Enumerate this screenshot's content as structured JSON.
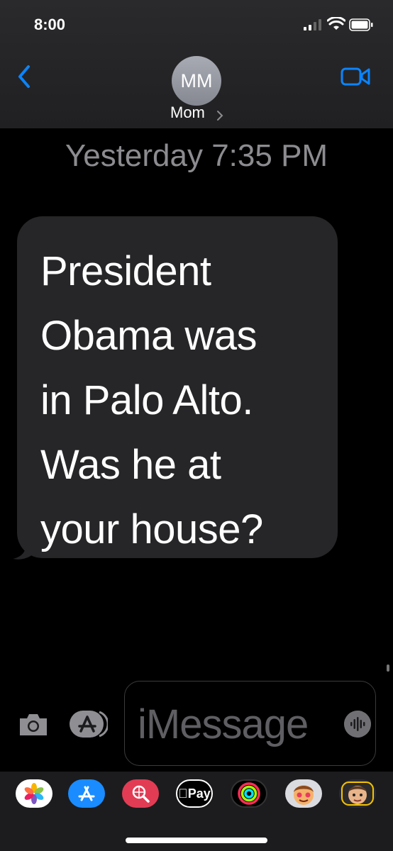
{
  "status_bar": {
    "time": "8:00"
  },
  "header": {
    "avatar_initials": "MM",
    "contact_name": "Mom"
  },
  "conversation": {
    "timestamp": "Yesterday 7:35 PM",
    "messages": [
      {
        "direction": "incoming",
        "text": "President\nObama was\nin Palo Alto.\nWas he at\nyour house?"
      }
    ]
  },
  "input_bar": {
    "placeholder": "iMessage"
  },
  "app_tray": {
    "items": [
      {
        "name": "photos-icon"
      },
      {
        "name": "app-store-icon"
      },
      {
        "name": "web-search-icon"
      },
      {
        "name": "apple-pay-icon",
        "label": "Pay"
      },
      {
        "name": "activity-icon"
      },
      {
        "name": "memoji-stickers-icon"
      },
      {
        "name": "memoji-icon"
      }
    ]
  },
  "colors": {
    "accent": "#0a84ff",
    "incoming_bubble": "#262628",
    "background": "#000000"
  }
}
